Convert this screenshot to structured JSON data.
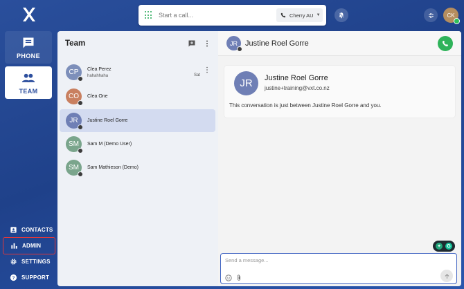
{
  "nav": {
    "phone_label": "PHONE",
    "team_label": "TEAM",
    "contacts_label": "CONTACTS",
    "admin_label": "ADMIN",
    "settings_label": "SETTINGS",
    "support_label": "SUPPORT"
  },
  "topbar": {
    "call_placeholder": "Start a call...",
    "line_label": "Cherry AU",
    "user_initials": "CK"
  },
  "team": {
    "title": "Team",
    "contacts": [
      {
        "initials": "CP",
        "name": "Clea Perez",
        "last_message": "hahahhaha",
        "time": "Sat"
      },
      {
        "initials": "CO",
        "name": "Clea One"
      },
      {
        "initials": "JR",
        "name": "Justine Roel Gorre"
      },
      {
        "initials": "SM",
        "name": "Sam M (Demo User)"
      },
      {
        "initials": "SM",
        "name": "Sam Mathieson (Demo)"
      }
    ]
  },
  "conversation": {
    "initials": "JR",
    "name": "Justine Roel Gorre",
    "email": "justine+training@vxt.co.nz",
    "note": "This conversation is just between Justine Roel Gorre and you.",
    "composer_placeholder": "Send a message..."
  },
  "colors": {
    "brand_blue": "#2a4f9c",
    "call_green": "#2fb35a",
    "highlight_red": "#e0383b",
    "selected_row": "#d3dbf0"
  }
}
